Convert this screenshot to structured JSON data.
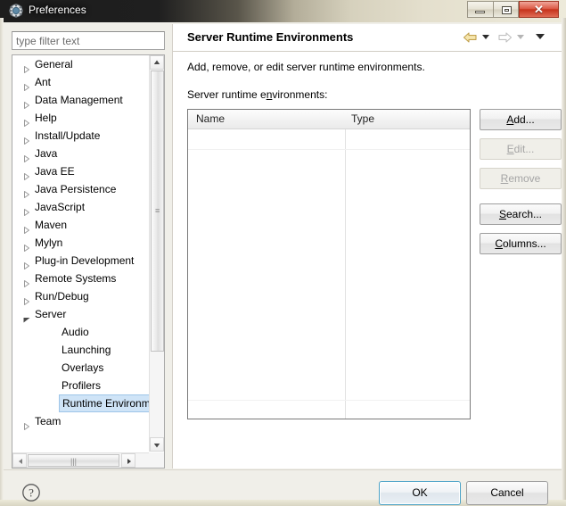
{
  "window": {
    "title": "Preferences",
    "icon": "preferences-gear-icon",
    "controls": {
      "minimize": "minimize-icon",
      "maximize": "maximize-icon",
      "close": "✕"
    }
  },
  "filter": {
    "placeholder": "type filter text",
    "value": ""
  },
  "tree": {
    "items": [
      {
        "label": "General",
        "state": "collapsed",
        "depth": 0
      },
      {
        "label": "Ant",
        "state": "collapsed",
        "depth": 0
      },
      {
        "label": "Data Management",
        "state": "collapsed",
        "depth": 0
      },
      {
        "label": "Help",
        "state": "collapsed",
        "depth": 0
      },
      {
        "label": "Install/Update",
        "state": "collapsed",
        "depth": 0
      },
      {
        "label": "Java",
        "state": "collapsed",
        "depth": 0
      },
      {
        "label": "Java EE",
        "state": "collapsed",
        "depth": 0
      },
      {
        "label": "Java Persistence",
        "state": "collapsed",
        "depth": 0
      },
      {
        "label": "JavaScript",
        "state": "collapsed",
        "depth": 0
      },
      {
        "label": "Maven",
        "state": "collapsed",
        "depth": 0
      },
      {
        "label": "Mylyn",
        "state": "collapsed",
        "depth": 0
      },
      {
        "label": "Plug-in Development",
        "state": "collapsed",
        "depth": 0
      },
      {
        "label": "Remote Systems",
        "state": "collapsed",
        "depth": 0
      },
      {
        "label": "Run/Debug",
        "state": "collapsed",
        "depth": 0
      },
      {
        "label": "Server",
        "state": "expanded",
        "depth": 0
      },
      {
        "label": "Audio",
        "state": "leaf",
        "depth": 1
      },
      {
        "label": "Launching",
        "state": "leaf",
        "depth": 1
      },
      {
        "label": "Overlays",
        "state": "leaf",
        "depth": 1
      },
      {
        "label": "Profilers",
        "state": "leaf",
        "depth": 1
      },
      {
        "label": "Runtime Environm",
        "state": "leaf",
        "depth": 1,
        "selected": true
      },
      {
        "label": "Team",
        "state": "collapsed",
        "depth": 0
      }
    ]
  },
  "content": {
    "title": "Server Runtime Environments",
    "description": "Add, remove, or edit server runtime environments.",
    "list_label_pre": "Server runtime e",
    "list_label_mnemonic": "n",
    "list_label_post": "vironments:",
    "nav": {
      "back_icon": "back-arrow-icon",
      "back_dropdown_icon": "chevron-down-icon",
      "forward_icon": "forward-arrow-icon",
      "forward_dropdown_icon": "chevron-down-icon",
      "menu_icon": "chevron-down-icon"
    },
    "table": {
      "columns": [
        "Name",
        "Type"
      ],
      "rows": []
    },
    "buttons": [
      {
        "pre": "",
        "mnemonic": "A",
        "post": "dd...",
        "enabled": true
      },
      {
        "pre": "",
        "mnemonic": "E",
        "post": "dit...",
        "enabled": false
      },
      {
        "pre": "",
        "mnemonic": "R",
        "post": "emove",
        "enabled": false
      },
      {
        "pre": "",
        "mnemonic": "S",
        "post": "earch...",
        "enabled": true
      },
      {
        "pre": "",
        "mnemonic": "C",
        "post": "olumns...",
        "enabled": true
      }
    ]
  },
  "footer": {
    "help_icon": "help-question-icon",
    "ok_label": "OK",
    "cancel_label": "Cancel"
  },
  "colors": {
    "title_bar_dark": "#1d1d1d",
    "close_button": "#c6331c",
    "selection_blue": "#cfe4f7",
    "default_button_border": "#4da3c7",
    "back_arrow_gold": "#e8c96a",
    "forward_arrow_gray": "#c9c9c9"
  }
}
